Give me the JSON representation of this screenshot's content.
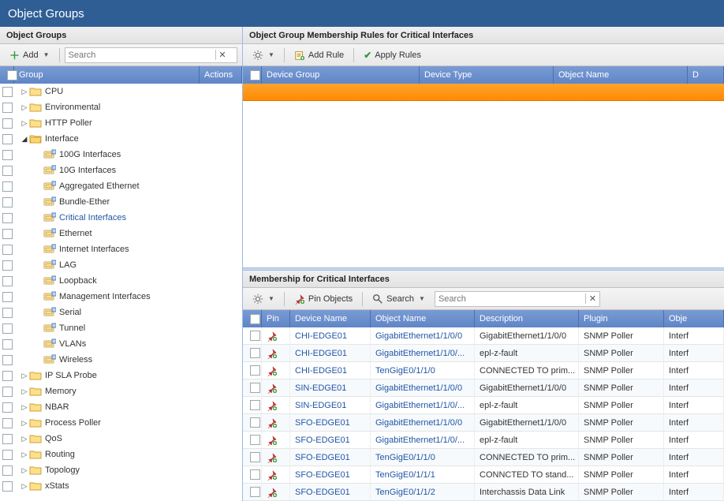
{
  "app_title": "Object Groups",
  "left": {
    "panel_title": "Object Groups",
    "add_label": "Add",
    "search_placeholder": "Search",
    "col_group": "Group",
    "col_actions": "Actions",
    "tree": [
      {
        "label": "CPU",
        "depth": 0,
        "type": "folder",
        "expand": "closed"
      },
      {
        "label": "Environmental",
        "depth": 0,
        "type": "folder",
        "expand": "closed"
      },
      {
        "label": "HTTP Poller",
        "depth": 0,
        "type": "folder",
        "expand": "closed"
      },
      {
        "label": "Interface",
        "depth": 0,
        "type": "folder-open",
        "expand": "open"
      },
      {
        "label": "100G Interfaces",
        "depth": 1,
        "type": "iface",
        "expand": "none"
      },
      {
        "label": "10G Interfaces",
        "depth": 1,
        "type": "iface",
        "expand": "none"
      },
      {
        "label": "Aggregated Ethernet",
        "depth": 1,
        "type": "iface",
        "expand": "none"
      },
      {
        "label": "Bundle-Ether",
        "depth": 1,
        "type": "iface",
        "expand": "none"
      },
      {
        "label": "Critical Interfaces",
        "depth": 1,
        "type": "iface",
        "expand": "none",
        "selected": true
      },
      {
        "label": "Ethernet",
        "depth": 1,
        "type": "iface",
        "expand": "none"
      },
      {
        "label": "Internet Interfaces",
        "depth": 1,
        "type": "iface",
        "expand": "none"
      },
      {
        "label": "LAG",
        "depth": 1,
        "type": "iface",
        "expand": "none"
      },
      {
        "label": "Loopback",
        "depth": 1,
        "type": "iface",
        "expand": "none"
      },
      {
        "label": "Management Interfaces",
        "depth": 1,
        "type": "iface",
        "expand": "none"
      },
      {
        "label": "Serial",
        "depth": 1,
        "type": "iface",
        "expand": "none"
      },
      {
        "label": "Tunnel",
        "depth": 1,
        "type": "iface",
        "expand": "none"
      },
      {
        "label": "VLANs",
        "depth": 1,
        "type": "iface",
        "expand": "none"
      },
      {
        "label": "Wireless",
        "depth": 1,
        "type": "iface",
        "expand": "none"
      },
      {
        "label": "IP SLA Probe",
        "depth": 0,
        "type": "folder",
        "expand": "closed"
      },
      {
        "label": "Memory",
        "depth": 0,
        "type": "folder",
        "expand": "closed"
      },
      {
        "label": "NBAR",
        "depth": 0,
        "type": "folder",
        "expand": "closed"
      },
      {
        "label": "Process Poller",
        "depth": 0,
        "type": "folder",
        "expand": "closed"
      },
      {
        "label": "QoS",
        "depth": 0,
        "type": "folder",
        "expand": "closed"
      },
      {
        "label": "Routing",
        "depth": 0,
        "type": "folder",
        "expand": "closed"
      },
      {
        "label": "Topology",
        "depth": 0,
        "type": "folder",
        "expand": "closed"
      },
      {
        "label": "xStats",
        "depth": 0,
        "type": "folder",
        "expand": "closed"
      }
    ]
  },
  "rules": {
    "panel_title": "Object Group Membership Rules for Critical Interfaces",
    "add_rule_label": "Add Rule",
    "apply_rules_label": "Apply Rules",
    "cols": {
      "device_group": "Device Group",
      "device_type": "Device Type",
      "object_name": "Object Name",
      "d": "D"
    }
  },
  "membership": {
    "panel_title": "Membership for Critical Interfaces",
    "pin_label": "Pin Objects",
    "search_btn_label": "Search",
    "search_placeholder": "Search",
    "cols": {
      "pin": "Pin",
      "device_name": "Device Name",
      "object_name": "Object Name",
      "description": "Description",
      "plugin": "Plugin",
      "obj": "Obje"
    },
    "rows": [
      {
        "device": "CHI-EDGE01",
        "object": "GigabitEthernet1/1/0/0",
        "desc": "GigabitEthernet1/1/0/0",
        "plugin": "SNMP Poller",
        "obj": "Interf"
      },
      {
        "device": "CHI-EDGE01",
        "object": "GigabitEthernet1/1/0/...",
        "desc": "epl-z-fault",
        "plugin": "SNMP Poller",
        "obj": "Interf"
      },
      {
        "device": "CHI-EDGE01",
        "object": "TenGigE0/1/1/0",
        "desc": "CONNECTED TO prim...",
        "plugin": "SNMP Poller",
        "obj": "Interf"
      },
      {
        "device": "SIN-EDGE01",
        "object": "GigabitEthernet1/1/0/0",
        "desc": "GigabitEthernet1/1/0/0",
        "plugin": "SNMP Poller",
        "obj": "Interf"
      },
      {
        "device": "SIN-EDGE01",
        "object": "GigabitEthernet1/1/0/...",
        "desc": "epl-z-fault",
        "plugin": "SNMP Poller",
        "obj": "Interf"
      },
      {
        "device": "SFO-EDGE01",
        "object": "GigabitEthernet1/1/0/0",
        "desc": "GigabitEthernet1/1/0/0",
        "plugin": "SNMP Poller",
        "obj": "Interf"
      },
      {
        "device": "SFO-EDGE01",
        "object": "GigabitEthernet1/1/0/...",
        "desc": "epl-z-fault",
        "plugin": "SNMP Poller",
        "obj": "Interf"
      },
      {
        "device": "SFO-EDGE01",
        "object": "TenGigE0/1/1/0",
        "desc": "CONNECTED TO prim...",
        "plugin": "SNMP Poller",
        "obj": "Interf"
      },
      {
        "device": "SFO-EDGE01",
        "object": "TenGigE0/1/1/1",
        "desc": "CONNCTED TO stand...",
        "plugin": "SNMP Poller",
        "obj": "Interf"
      },
      {
        "device": "SFO-EDGE01",
        "object": "TenGigE0/1/1/2",
        "desc": "Interchassis Data Link",
        "plugin": "SNMP Poller",
        "obj": "Interf"
      }
    ]
  }
}
